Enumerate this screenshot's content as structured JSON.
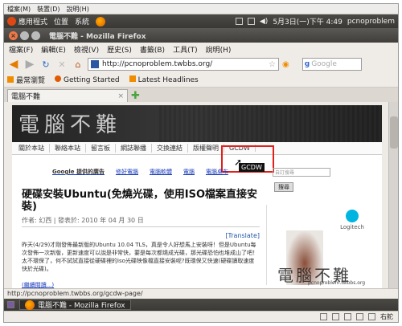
{
  "top_menubar": [
    "檔案(M)",
    "裝置(D)",
    "說明(H)"
  ],
  "panel": {
    "menus": [
      "應用程式",
      "位置",
      "系統"
    ],
    "datetime": "5月3日(一)下午 4:49",
    "user": "pcnoproblem"
  },
  "window": {
    "title": "電腦不難 - Mozilla Firefox"
  },
  "ff_menu": [
    "檔案(F)",
    "編輯(E)",
    "檢視(V)",
    "歷史(S)",
    "書籤(B)",
    "工具(T)",
    "說明(H)"
  ],
  "nav": {
    "url": "http://pcnoproblem.twbbs.org/",
    "search_placeholder": "Google"
  },
  "bookmarks": [
    "最常瀏覽",
    "Getting Started",
    "Latest Headlines"
  ],
  "tabs": [
    {
      "label": "電腦不難"
    }
  ],
  "site": {
    "logo": "電腦不難",
    "nav": [
      "關於本站",
      "聯絡本站",
      "留言板",
      "網誌聯播",
      "交換連結",
      "版權聲明",
      "GCDW"
    ],
    "tooltip": "GCDW",
    "ads_label": "Google 提供的廣告",
    "ads": [
      "修好電腦",
      "電腦軟體",
      "電腦",
      "電腦桌布"
    ],
    "search_button": "搜尋",
    "search_placeholder": "自訂搜尋",
    "article": {
      "title": "硬碟安裝Ubuntu(免燒光碟，使用ISO檔案直接安裝)",
      "meta": "作者: 幻西 | 發表於: 2010 年 04 月 30 日",
      "translate": "[Translate]",
      "body": "昨天(4/29)才剛發佈最新版的Ubuntu 10.04 TLS，真是令人好想馬上安裝呀！但是Ubuntu每次發佈一次新版，更新速度可以說是非常快，要是每次都燒成光碟，那光碟恐怕也堆成山了吧！太不環保了，何不試試直接從硬碟裡的iso光碟映像檔直接安裝呢?既環保又快速(硬碟讀取速度快於光碟)。",
      "read_more": "(繼續閱讀...)"
    },
    "sponsor": "Logitech",
    "watermark": "電腦不難",
    "watermark_sub": "pcnoproblem.twbbs.org"
  },
  "status_text": "http://pcnoproblem.twbbs.org/gcdw-page/",
  "taskbar": {
    "task": "電腦不難 - Mozilla Firefox"
  },
  "bottom_bar": {
    "ime": "右舵"
  }
}
